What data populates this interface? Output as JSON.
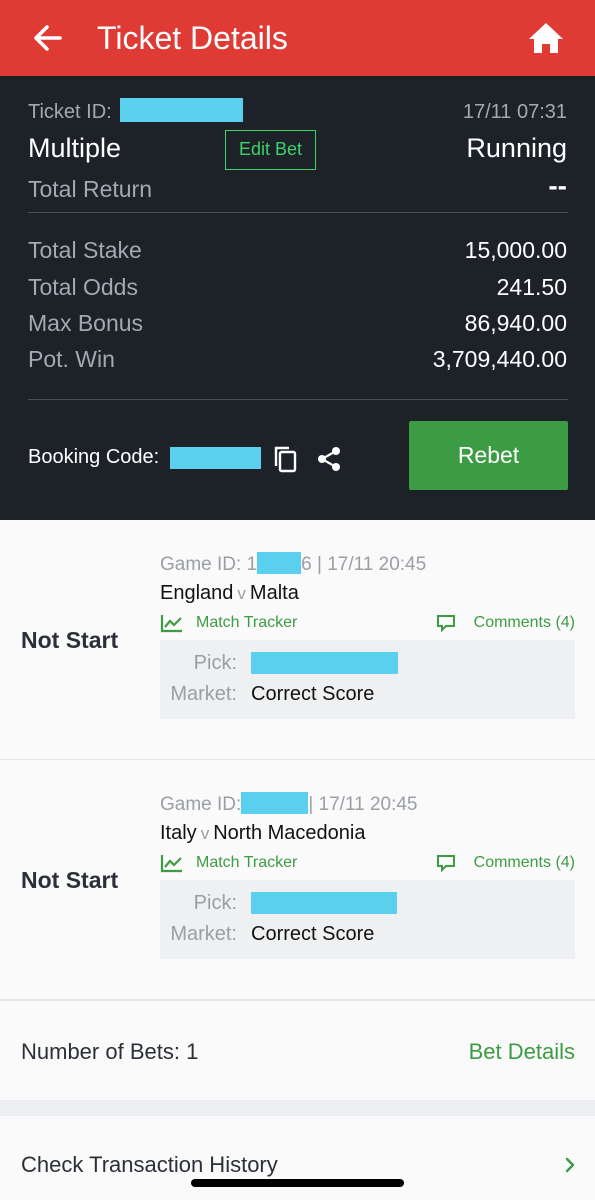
{
  "header": {
    "title": "Ticket Details",
    "back_icon": "arrow-left-icon",
    "home_icon": "home-icon",
    "background": "#e03a35"
  },
  "ticket": {
    "id_label": "Ticket ID:",
    "datetime": "17/11 07:31",
    "bet_type": "Multiple",
    "edit_bet_label": "Edit Bet",
    "status": "Running",
    "total_return_label": "Total Return",
    "total_return_value": "--",
    "rows": [
      {
        "label": "Total Stake",
        "value": "15,000.00"
      },
      {
        "label": "Total Odds",
        "value": "241.50"
      },
      {
        "label": "Max Bonus",
        "value": "86,940.00"
      },
      {
        "label": "Pot. Win",
        "value": "3,709,440.00"
      }
    ],
    "booking_code_label": "Booking Code:",
    "rebet_label": "Rebet",
    "accent": "#3bd36a",
    "button_color": "#3c9c43"
  },
  "bets": [
    {
      "state": "Not Start",
      "game_id_label": "Game ID: 1",
      "game_id_suffix": "6 | 17/11 20:45",
      "home": "England",
      "vs": "v",
      "away": "Malta",
      "tracker_label": "Match Tracker",
      "comments_label": "Comments (4)",
      "pick_label": "Pick:",
      "market_label": "Market:",
      "market_value": "Correct Score"
    },
    {
      "state": "Not Start",
      "game_id_label": "Game ID:",
      "game_id_suffix": "| 17/11 20:45",
      "home": "Italy",
      "vs": "v",
      "away": "North Macedonia",
      "tracker_label": "Match Tracker",
      "comments_label": "Comments (4)",
      "pick_label": "Pick:",
      "market_label": "Market:",
      "market_value": "Correct Score"
    }
  ],
  "footer": {
    "number_of_bets": "Number of Bets: 1",
    "bet_details_label": "Bet Details",
    "history_label": "Check Transaction History"
  }
}
